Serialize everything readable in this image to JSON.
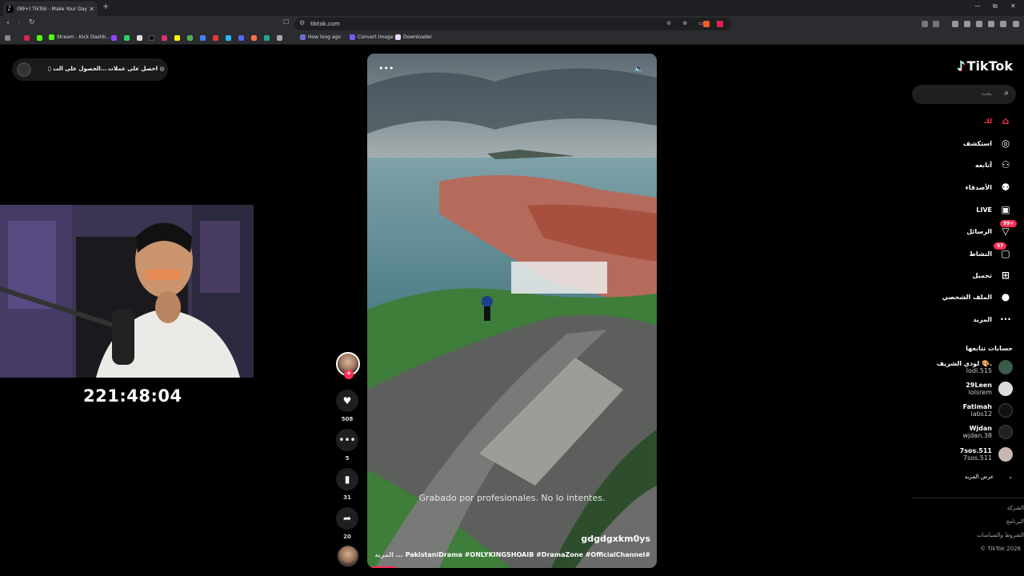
{
  "browser": {
    "tab_title": "(99+) TikTok - Make Your Day",
    "new_tab": "+",
    "url": "tiktok.com",
    "win_min": "—",
    "win_restore": "⧉",
    "win_close": "✕"
  },
  "bookmarks": [
    {
      "label": "Stream - Kick Dashb...",
      "color": "#53fc18"
    },
    {
      "label": "How long ago",
      "color": "#6b6bd6"
    },
    {
      "label": "Convert Image",
      "color": "#7a5cf0"
    },
    {
      "label": "Downloader",
      "color": "#e9d9ff"
    }
  ],
  "topbar": {
    "get_coins": "احصل على عملات",
    "get_app": "الحصول على الت..."
  },
  "stream_timer": "221:48:04",
  "video": {
    "subtitle": "Grabado por profesionales. No lo intentes.",
    "author": "gdgdgxkm0ys",
    "hashtags": "#PakistaniDrama #ONLYKINGSHOAIB #DramaZone #OfficialChannel ...",
    "more": "المزيد",
    "menu_icon": "•••",
    "sound_icon": "🔈"
  },
  "actions": {
    "likes": "508",
    "comments": "5",
    "saves": "31",
    "shares": "20"
  },
  "sidebar": {
    "logo": "TikTok",
    "search_placeholder": "بحث",
    "nav": [
      {
        "label": "لك",
        "active": true
      },
      {
        "label": "استكشف"
      },
      {
        "label": "أتابعه"
      },
      {
        "label": "الأصدقاء"
      },
      {
        "label": "LIVE"
      },
      {
        "label": "الرسائل",
        "badge": "99+"
      },
      {
        "label": "النشاط",
        "badge": "57"
      },
      {
        "label": "تحميل"
      },
      {
        "label": "الملف الشخصي"
      },
      {
        "label": "المزيد"
      }
    ],
    "following_title": "حسابات تتابعها",
    "accounts": [
      {
        "name": "لودي الشريف 🎨.",
        "handle": "lodi.515"
      },
      {
        "name": "29Leen",
        "handle": "lolsrem"
      },
      {
        "name": "Fatimah",
        "handle": "iabs12"
      },
      {
        "name": "Wjdan",
        "handle": "wjdan.38"
      },
      {
        "name": "7sos.511",
        "handle": "7sos.511"
      }
    ],
    "see_more": "عرض المزيد",
    "footer": [
      "الشركة",
      "البرنامج",
      "الشروط والسياسات",
      "© TikTok 2026"
    ]
  }
}
